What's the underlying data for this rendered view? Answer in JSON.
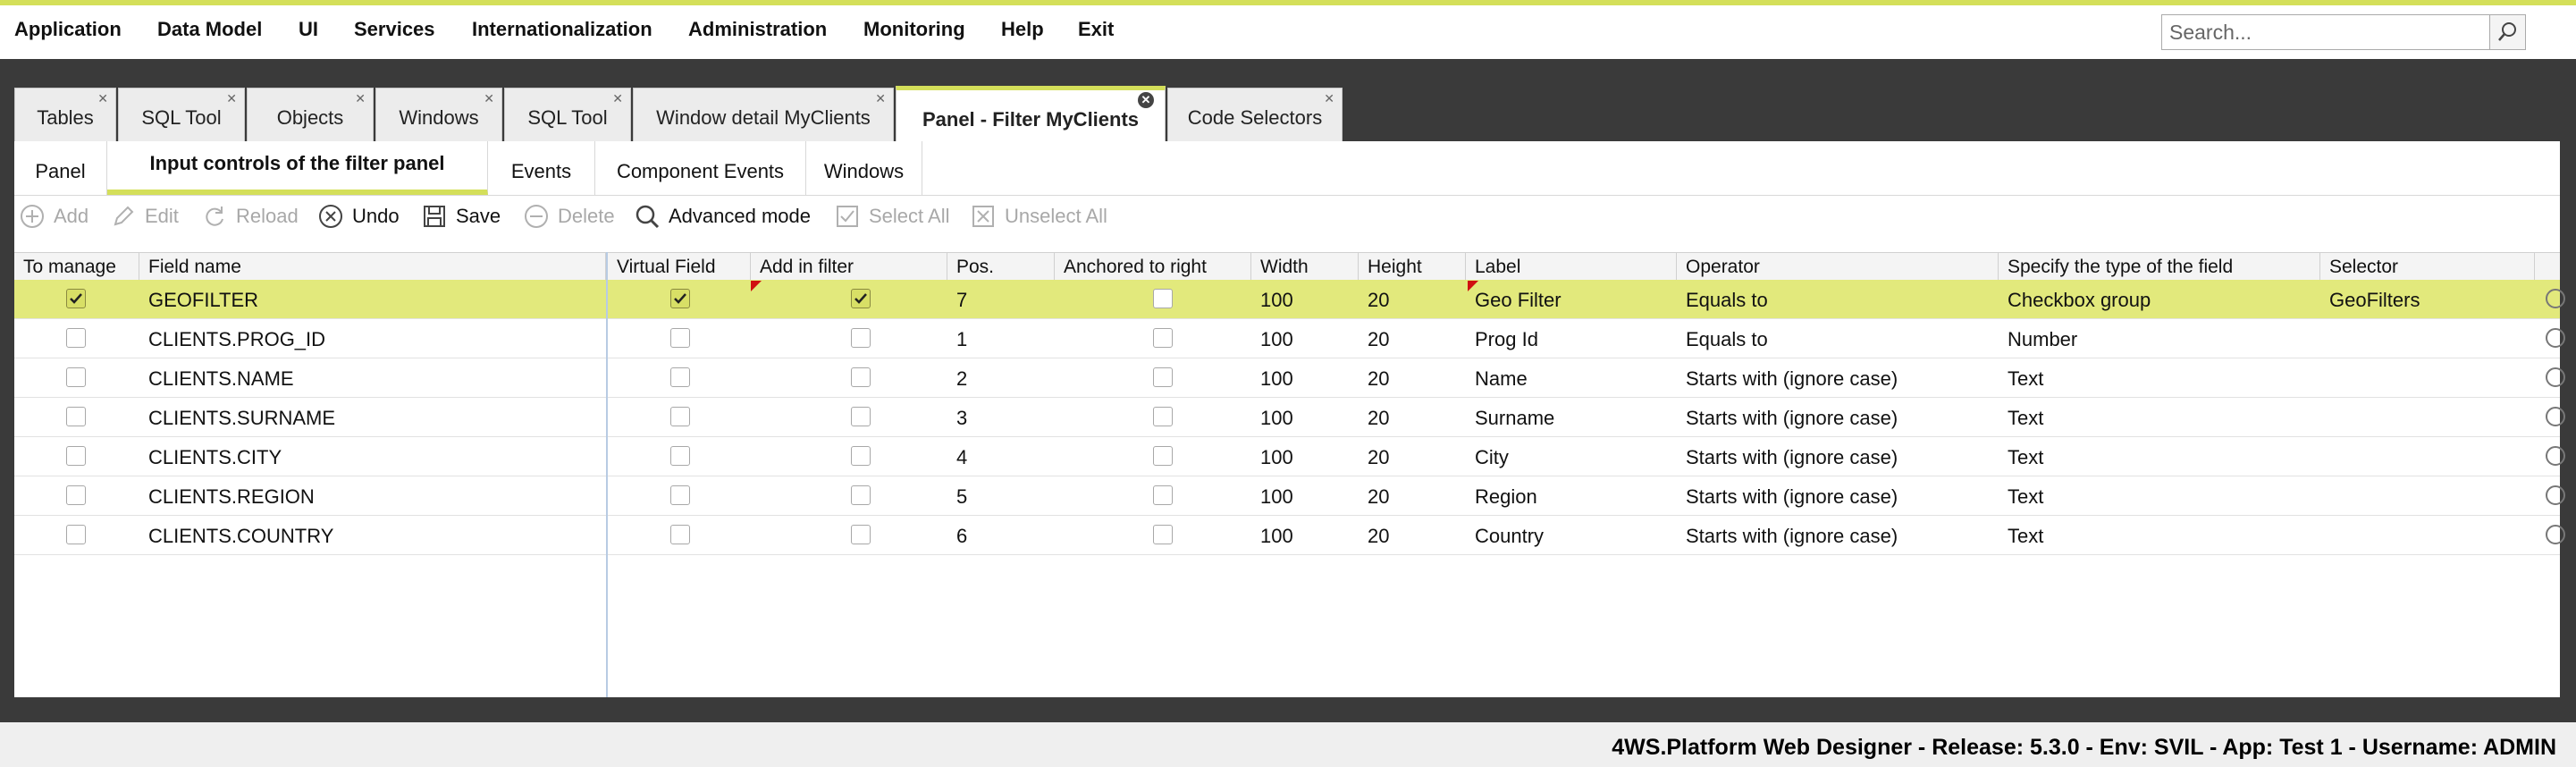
{
  "menu": [
    {
      "label": "Application"
    },
    {
      "label": "Data Model"
    },
    {
      "label": "UI"
    },
    {
      "label": "Services"
    },
    {
      "label": "Internationalization"
    },
    {
      "label": "Administration"
    },
    {
      "label": "Monitoring"
    },
    {
      "label": "Help"
    },
    {
      "label": "Exit"
    }
  ],
  "search": {
    "placeholder": "Search..."
  },
  "tabs": [
    {
      "label": "Tables"
    },
    {
      "label": "SQL Tool"
    },
    {
      "label": "Objects"
    },
    {
      "label": "Windows"
    },
    {
      "label": "SQL Tool"
    },
    {
      "label": "Window detail MyClients"
    },
    {
      "label": "Panel - Filter MyClients",
      "active": true
    },
    {
      "label": "Code Selectors"
    }
  ],
  "subtabs": [
    {
      "label": "Panel"
    },
    {
      "label": "Input controls of the filter panel",
      "active": true
    },
    {
      "label": "Events"
    },
    {
      "label": "Component Events"
    },
    {
      "label": "Windows"
    }
  ],
  "toolbar": {
    "add": "Add",
    "edit": "Edit",
    "reload": "Reload",
    "undo": "Undo",
    "save": "Save",
    "delete": "Delete",
    "advanced": "Advanced mode",
    "select_all": "Select All",
    "unselect_all": "Unselect All"
  },
  "grid": {
    "columns": [
      "To manage",
      "Field name",
      "Virtual Field",
      "Add in filter",
      "Pos.",
      "Anchored to right",
      "Width",
      "Height",
      "Label",
      "Operator",
      "Specify the type of the field",
      "Selector"
    ],
    "rows": [
      {
        "to_manage": true,
        "field": "GEOFILTER",
        "virtual": true,
        "in_filter": true,
        "pos": "7",
        "anchored": false,
        "width": "100",
        "height": "20",
        "label": "Geo Filter",
        "operator": "Equals to",
        "type": "Checkbox group",
        "selector": "GeoFilters",
        "selected": true
      },
      {
        "to_manage": false,
        "field": "CLIENTS.PROG_ID",
        "virtual": false,
        "in_filter": false,
        "pos": "1",
        "anchored": false,
        "width": "100",
        "height": "20",
        "label": "Prog Id",
        "operator": "Equals to",
        "type": "Number",
        "selector": ""
      },
      {
        "to_manage": false,
        "field": "CLIENTS.NAME",
        "virtual": false,
        "in_filter": false,
        "pos": "2",
        "anchored": false,
        "width": "100",
        "height": "20",
        "label": "Name",
        "operator": "Starts with (ignore case)",
        "type": "Text",
        "selector": ""
      },
      {
        "to_manage": false,
        "field": "CLIENTS.SURNAME",
        "virtual": false,
        "in_filter": false,
        "pos": "3",
        "anchored": false,
        "width": "100",
        "height": "20",
        "label": "Surname",
        "operator": "Starts with (ignore case)",
        "type": "Text",
        "selector": ""
      },
      {
        "to_manage": false,
        "field": "CLIENTS.CITY",
        "virtual": false,
        "in_filter": false,
        "pos": "4",
        "anchored": false,
        "width": "100",
        "height": "20",
        "label": "City",
        "operator": "Starts with (ignore case)",
        "type": "Text",
        "selector": ""
      },
      {
        "to_manage": false,
        "field": "CLIENTS.REGION",
        "virtual": false,
        "in_filter": false,
        "pos": "5",
        "anchored": false,
        "width": "100",
        "height": "20",
        "label": "Region",
        "operator": "Starts with (ignore case)",
        "type": "Text",
        "selector": ""
      },
      {
        "to_manage": false,
        "field": "CLIENTS.COUNTRY",
        "virtual": false,
        "in_filter": false,
        "pos": "6",
        "anchored": false,
        "width": "100",
        "height": "20",
        "label": "Country",
        "operator": "Starts with (ignore case)",
        "type": "Text",
        "selector": ""
      }
    ]
  },
  "status": {
    "text": "4WS.Platform Web Designer - Release: 5.3.0 - Env: SVIL - App: Test 1 - Username: ADMIN"
  },
  "colors": {
    "accent": "#d4df5a",
    "selected_row": "#e2e97c",
    "background": "#3a3a3a"
  }
}
